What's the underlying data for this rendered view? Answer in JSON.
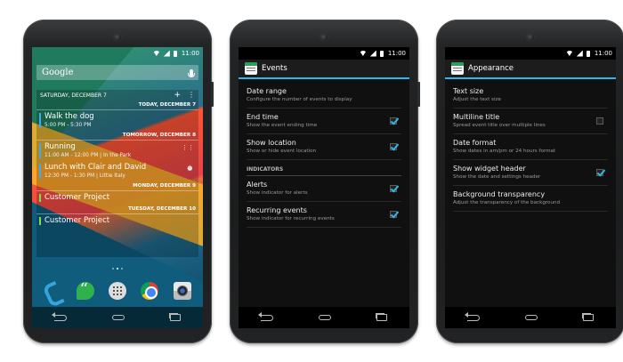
{
  "status_bar": {
    "time": "11:00"
  },
  "home": {
    "search_logo": "Google",
    "widget": {
      "date": "SATURDAY, DECEMBER 7",
      "add_symbol": "+",
      "menu_symbol": "⋮",
      "days": [
        {
          "label": "TODAY, DECEMBER 7",
          "events": [
            {
              "title": "Walk the dog",
              "time": "5:00 PM - 5:30 PM",
              "color": "#4aa6e8"
            }
          ]
        },
        {
          "label": "TOMORROW, DECEMBER 8",
          "events": [
            {
              "title": "Running",
              "time": "11:00 AM - 12:00 PM | In the Park",
              "color": "#4aa6e8",
              "icon": "repeat-icon"
            },
            {
              "title": "Lunch with Clair and David",
              "time": "12:30 PM - 1:30 PM | Little Italy",
              "color": "#4aa6e8",
              "icon": "alarm-icon"
            }
          ]
        },
        {
          "label": "MONDAY, DECEMBER 9",
          "events": [
            {
              "title": "Customer Project",
              "time": "",
              "color": "#7ed957"
            }
          ]
        },
        {
          "label": "TUESDAY, DECEMBER 10",
          "events": [
            {
              "title": "Customer Project",
              "time": "",
              "color": "#7ed957"
            }
          ]
        }
      ]
    },
    "dock": [
      "phone-app-icon",
      "hangouts-app-icon",
      "app-drawer-icon",
      "chrome-app-icon",
      "camera-app-icon"
    ]
  },
  "events_screen": {
    "title": "Events",
    "prefs": [
      {
        "title": "Date range",
        "summary": "Configure the number of events to display",
        "checkbox": null
      },
      {
        "title": "End time",
        "summary": "Show the event ending time",
        "checkbox": true
      },
      {
        "title": "Show location",
        "summary": "Show or hide event location",
        "checkbox": true
      }
    ],
    "category": "INDICATORS",
    "indicator_prefs": [
      {
        "title": "Alerts",
        "summary": "Show indicator for alerts",
        "checkbox": true
      },
      {
        "title": "Recurring events",
        "summary": "Show indicator for recurring events",
        "checkbox": true
      }
    ]
  },
  "appearance_screen": {
    "title": "Appearance",
    "prefs": [
      {
        "title": "Text size",
        "summary": "Adjust the text size",
        "checkbox": null
      },
      {
        "title": "Multiline title",
        "summary": "Spread event title over multiple lines",
        "checkbox": false
      },
      {
        "title": "Date format",
        "summary": "Show dates in am/pm or 24 hours format",
        "checkbox": null
      },
      {
        "title": "Show widget header",
        "summary": "Show the date and settings header",
        "checkbox": true
      },
      {
        "title": "Background transparency",
        "summary": "Adjust the transparency of the background",
        "checkbox": null
      }
    ]
  },
  "colors": {
    "accent": "#33b5e5",
    "event_blue": "#4aa6e8",
    "event_green": "#7ed957"
  }
}
